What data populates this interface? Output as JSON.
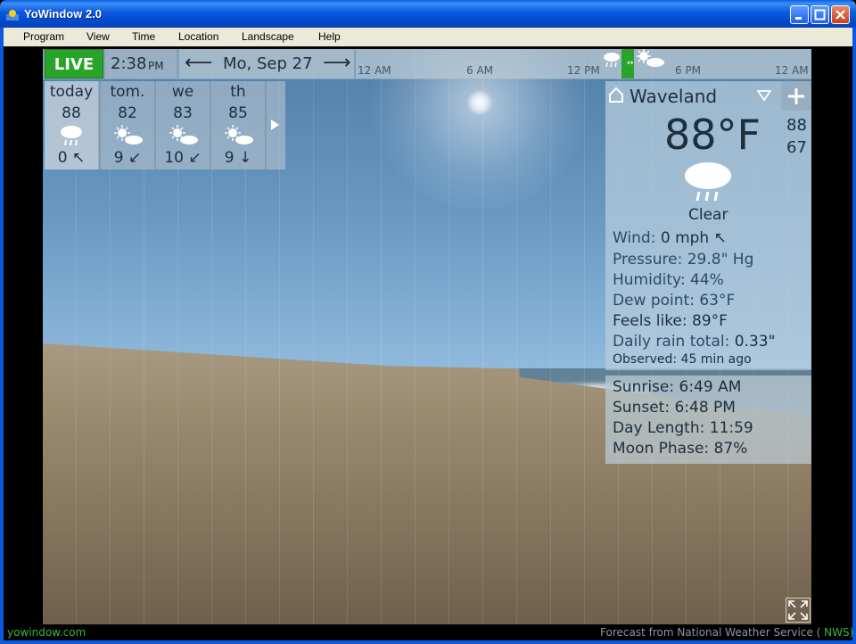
{
  "window": {
    "title": "YoWindow 2.0"
  },
  "menu": [
    "Program",
    "View",
    "Time",
    "Location",
    "Landscape",
    "Help"
  ],
  "topbar": {
    "live_label": "LIVE",
    "time": "2:38",
    "ampm": "PM",
    "date": "Mo, Sep 27",
    "prev_arrow": "⟵",
    "next_arrow": "⟶",
    "timeline_labels": [
      "12 AM",
      "6 AM",
      "12 PM",
      "6 PM",
      "12 AM"
    ]
  },
  "forecast": {
    "days": [
      {
        "name": "today",
        "temp": "88",
        "icon": "rain-cloud-icon",
        "rain": "0 ↖"
      },
      {
        "name": "tom.",
        "temp": "82",
        "icon": "partly-cloudy-icon",
        "rain": "9 ↙"
      },
      {
        "name": "we",
        "temp": "83",
        "icon": "partly-cloudy-icon",
        "rain": "10 ↙"
      },
      {
        "name": "th",
        "temp": "85",
        "icon": "partly-cloudy-icon",
        "rain": "9 ↓"
      }
    ]
  },
  "panel": {
    "location": "Waveland",
    "temp": "88°F",
    "high": "88",
    "low": "67",
    "condition": "Clear",
    "wind_label": "Wind:",
    "wind_value": "0 mph",
    "wind_arrow": "↖",
    "pressure_label": "Pressure:",
    "pressure_value": "29.8\" Hg",
    "humidity_label": "Humidity:",
    "humidity_value": "44%",
    "dewpoint_label": "Dew point:",
    "dewpoint_value": "63°F",
    "feels_label": "Feels like:",
    "feels_value": "89°F",
    "rain_label": "Daily rain total:",
    "rain_value": "0.33\"",
    "observed_label": "Observed:",
    "observed_value": "45 min ago",
    "sunrise_label": "Sunrise:",
    "sunrise_value": "6:49 AM",
    "sunset_label": "Sunset:",
    "sunset_value": "6:48 PM",
    "daylength_label": "Day Length:",
    "daylength_value": "11:59",
    "moon_label": "Moon Phase:",
    "moon_value": "87%"
  },
  "footer": {
    "site": "yowindow.com",
    "forecast_text": "Forecast from National Weather Service (",
    "source": "NWS)"
  }
}
